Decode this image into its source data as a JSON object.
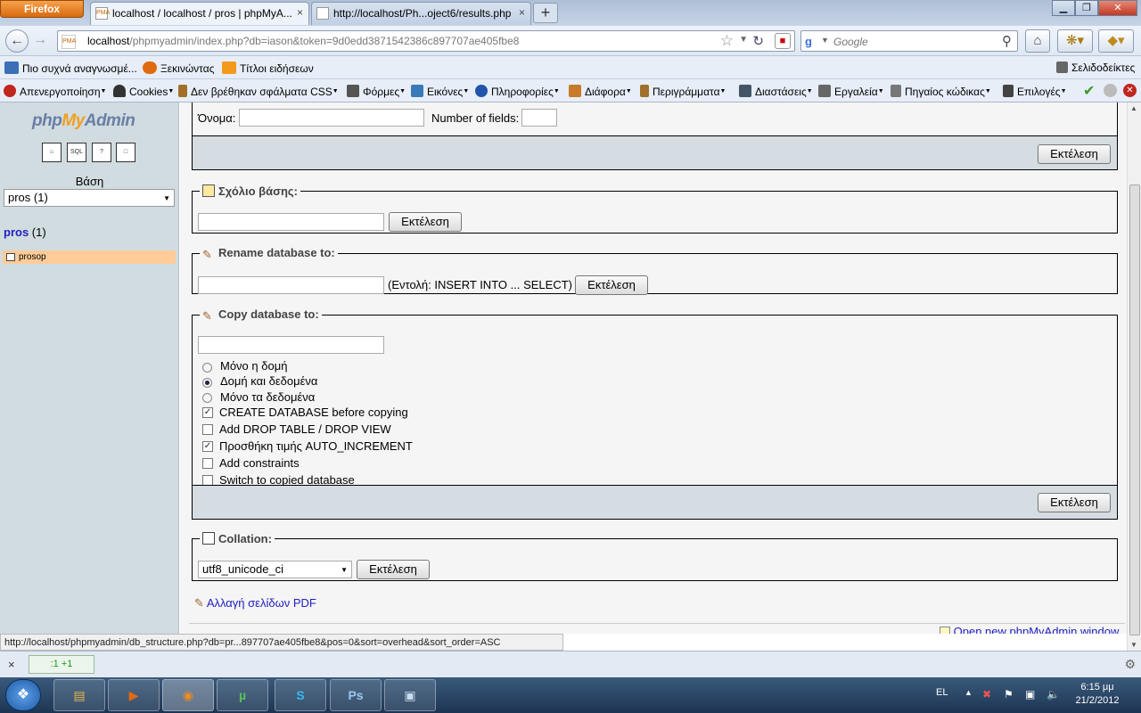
{
  "browser": {
    "app_button": "Firefox",
    "tabs": [
      {
        "label": "localhost / localhost / pros | phpMyA...",
        "icon": "PMA",
        "close": "×",
        "active": true
      },
      {
        "label": "http://localhost/Ph...oject6/results.php",
        "close": "×",
        "active": false
      }
    ],
    "new_tab": "+",
    "window_controls": {
      "minimize": "▁",
      "maximize": "❐",
      "close": "✕"
    },
    "url_host": "localhost",
    "url_rest": "/phpmyadmin/index.php?db=iason&token=9d0edd3871542386c897707ae405fbe8",
    "search_engine_icon": "google-icon",
    "search_placeholder": "Google",
    "bookmarks": [
      {
        "label": "Πιο συχνά αναγνωσμέ...",
        "icon": "most-visited-icon",
        "color": "#3b6fb6"
      },
      {
        "label": "Ξεκινώντας",
        "icon": "firefox-icon",
        "color": "#e06a10"
      },
      {
        "label": "Τίτλοι ειδήσεων",
        "icon": "rss-icon",
        "color": "#f39a1c"
      }
    ],
    "bookmarks_menu": "Σελιδοδείκτες",
    "devbar": [
      {
        "label": "Απενεργοποίηση",
        "icon": "disable-icon",
        "color": "#c0261c"
      },
      {
        "label": "Cookies",
        "icon": "cookies-icon",
        "color": "#333333"
      },
      {
        "label": "Δεν βρέθηκαν σφάλματα CSS",
        "icon": "css-pencil-icon",
        "color": "#a0702a"
      },
      {
        "label": "Φόρμες",
        "icon": "forms-icon",
        "color": "#555555"
      },
      {
        "label": "Εικόνες",
        "icon": "images-icon",
        "color": "#3a79b8"
      },
      {
        "label": "Πληροφορίες",
        "icon": "info-icon",
        "color": "#2255aa"
      },
      {
        "label": "Διάφορα",
        "icon": "misc-icon",
        "color": "#c67a2a"
      },
      {
        "label": "Περιγράμματα",
        "icon": "outline-icon",
        "color": "#a0702a"
      },
      {
        "label": "Διαστάσεις",
        "icon": "resize-icon",
        "color": "#445566"
      },
      {
        "label": "Εργαλεία",
        "icon": "tools-icon",
        "color": "#666666"
      },
      {
        "label": "Πηγαίος κώδικας",
        "icon": "source-icon",
        "color": "#777777"
      },
      {
        "label": "Επιλογές",
        "icon": "options-icon",
        "color": "#444444"
      }
    ]
  },
  "left": {
    "logo_php": "php",
    "logo_my": "My",
    "logo_admin": "Admin",
    "icons": [
      "home-icon",
      "sql-icon",
      "docs-icon",
      "query-window-icon"
    ],
    "db_label": "Βάση",
    "db_select": "pros (1)",
    "db_name": "pros",
    "db_count": "(1)",
    "table": "prosop"
  },
  "main": {
    "create_table": {
      "name_label": "Όνομα:",
      "fields_label": "Number of fields:",
      "go": "Εκτέλεση"
    },
    "comment": {
      "legend": "Σχόλιο βάσης:",
      "go": "Εκτέλεση"
    },
    "rename": {
      "legend": "Rename database to:",
      "hint": "(Εντολή: INSERT INTO ... SELECT)",
      "go": "Εκτέλεση"
    },
    "copy": {
      "legend": "Copy database to:",
      "radios": [
        {
          "label": "Μόνο η δομή",
          "checked": false
        },
        {
          "label": "Δομή και δεδομένα",
          "checked": true
        },
        {
          "label": "Μόνο τα δεδομένα",
          "checked": false
        }
      ],
      "checks": [
        {
          "label": "CREATE DATABASE before copying",
          "checked": true
        },
        {
          "label": "Add DROP TABLE / DROP VIEW",
          "checked": false
        },
        {
          "label": "Προσθήκη τιμής AUTO_INCREMENT",
          "checked": true
        },
        {
          "label": "Add constraints",
          "checked": false
        },
        {
          "label": "Switch to copied database",
          "checked": false
        }
      ],
      "go": "Εκτέλεση"
    },
    "collation": {
      "legend": "Collation:",
      "value": "utf8_unicode_ci",
      "go": "Εκτέλεση"
    },
    "pdf_link": "Αλλαγή σελίδων PDF",
    "new_window_link": "Open new phpMyAdmin window"
  },
  "status": {
    "url": "http://localhost/phpmyadmin/db_structure.php?db=pr...897707ae405fbe8&pos=0&sort=overhead&sort_order=ASC",
    "addon_counter": ":1 +1",
    "close": "×"
  },
  "taskbar": {
    "apps": [
      {
        "name": "explorer-icon",
        "label": "▤",
        "color": "#e8b64a"
      },
      {
        "name": "media-player-icon",
        "label": "▶",
        "color": "#e86a10"
      },
      {
        "name": "firefox-icon",
        "label": "◉",
        "color": "#e06a10"
      },
      {
        "name": "utorrent-icon",
        "label": "µ",
        "color": "#3aa03a"
      },
      {
        "name": "skype-icon",
        "label": "S",
        "color": "#1aa0e0"
      },
      {
        "name": "photoshop-icon",
        "label": "Ps",
        "color": "#1c2e5a"
      },
      {
        "name": "virtualbox-icon",
        "label": "▣",
        "color": "#9bb8d8"
      }
    ],
    "lang": "EL",
    "time": "6:15 μμ",
    "date": "21/2/2012"
  }
}
